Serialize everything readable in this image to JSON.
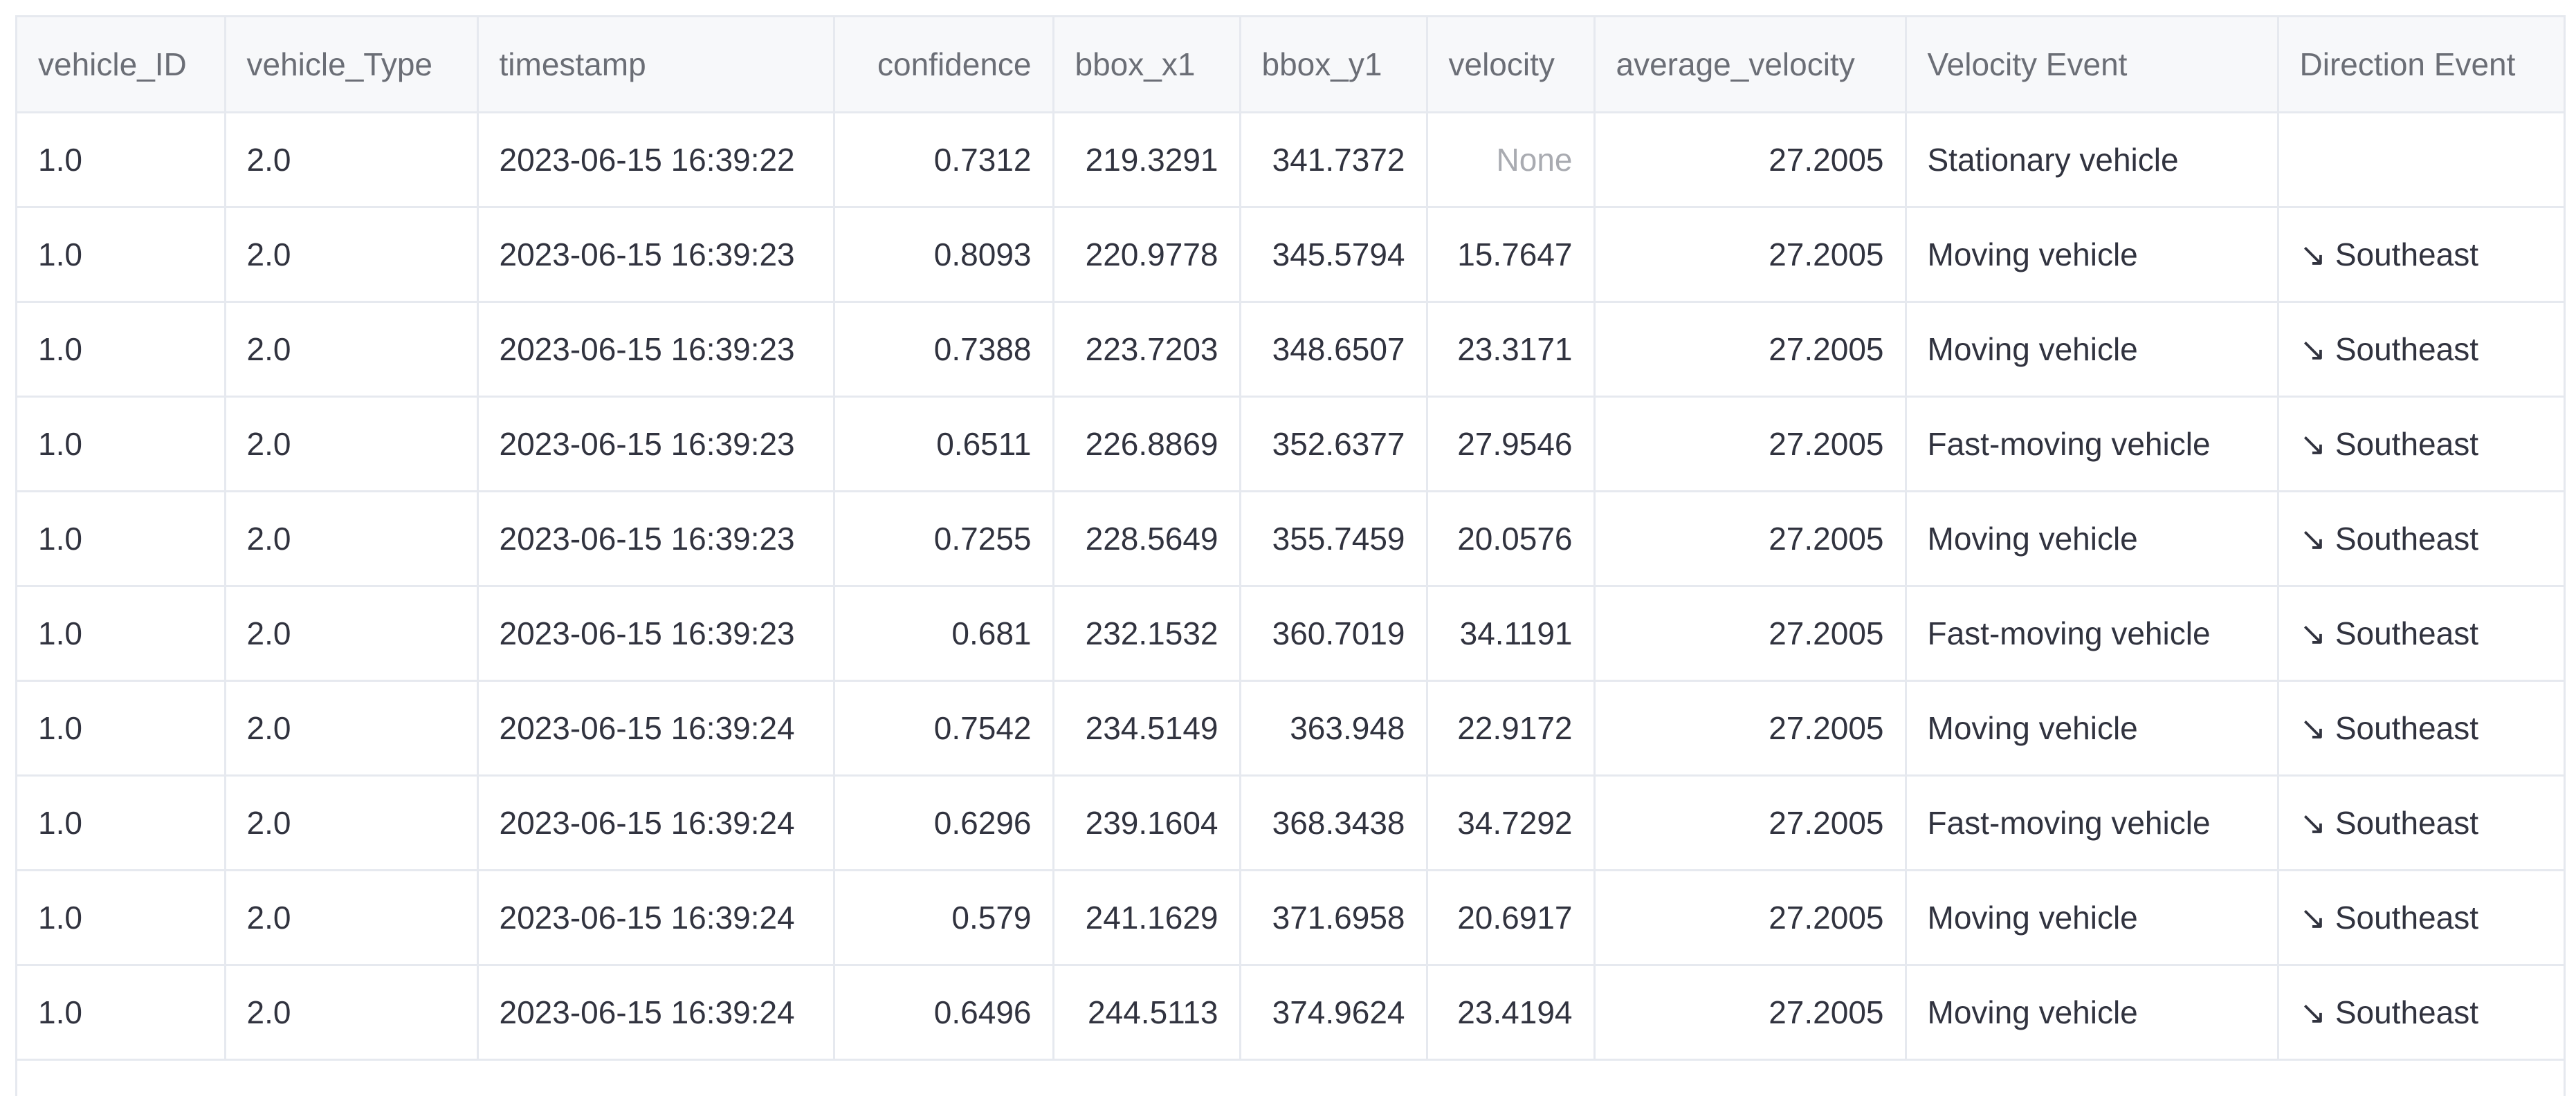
{
  "table": {
    "columns": [
      {
        "label": "vehicle_ID",
        "align": "left"
      },
      {
        "label": "vehicle_Type",
        "align": "left"
      },
      {
        "label": "timestamp",
        "align": "left"
      },
      {
        "label": "confidence",
        "align": "right"
      },
      {
        "label": "bbox_x1",
        "align": "left"
      },
      {
        "label": "bbox_y1",
        "align": "left"
      },
      {
        "label": "velocity",
        "align": "left"
      },
      {
        "label": "average_velocity",
        "align": "left"
      },
      {
        "label": "Velocity Event",
        "align": "left"
      },
      {
        "label": "Direction Event",
        "align": "left"
      }
    ],
    "rows": [
      [
        "1.0",
        "2.0",
        "2023-06-15 16:39:22",
        "0.7312",
        "219.3291",
        "341.7372",
        "None",
        "27.2005",
        "Stationary vehicle",
        ""
      ],
      [
        "1.0",
        "2.0",
        "2023-06-15 16:39:23",
        "0.8093",
        "220.9778",
        "345.5794",
        "15.7647",
        "27.2005",
        "Moving vehicle",
        "↘ Southeast"
      ],
      [
        "1.0",
        "2.0",
        "2023-06-15 16:39:23",
        "0.7388",
        "223.7203",
        "348.6507",
        "23.3171",
        "27.2005",
        "Moving vehicle",
        "↘ Southeast"
      ],
      [
        "1.0",
        "2.0",
        "2023-06-15 16:39:23",
        "0.6511",
        "226.8869",
        "352.6377",
        "27.9546",
        "27.2005",
        "Fast-moving vehicle",
        "↘ Southeast"
      ],
      [
        "1.0",
        "2.0",
        "2023-06-15 16:39:23",
        "0.7255",
        "228.5649",
        "355.7459",
        "20.0576",
        "27.2005",
        "Moving vehicle",
        "↘ Southeast"
      ],
      [
        "1.0",
        "2.0",
        "2023-06-15 16:39:23",
        "0.681",
        "232.1532",
        "360.7019",
        "34.1191",
        "27.2005",
        "Fast-moving vehicle",
        "↘ Southeast"
      ],
      [
        "1.0",
        "2.0",
        "2023-06-15 16:39:24",
        "0.7542",
        "234.5149",
        "363.948",
        "22.9172",
        "27.2005",
        "Moving vehicle",
        "↘ Southeast"
      ],
      [
        "1.0",
        "2.0",
        "2023-06-15 16:39:24",
        "0.6296",
        "239.1604",
        "368.3438",
        "34.7292",
        "27.2005",
        "Fast-moving vehicle",
        "↘ Southeast"
      ],
      [
        "1.0",
        "2.0",
        "2023-06-15 16:39:24",
        "0.579",
        "241.1629",
        "371.6958",
        "20.6917",
        "27.2005",
        "Moving vehicle",
        "↘ Southeast"
      ],
      [
        "1.0",
        "2.0",
        "2023-06-15 16:39:24",
        "0.6496",
        "244.5113",
        "374.9624",
        "23.4194",
        "27.2005",
        "Moving vehicle",
        "↘ Southeast"
      ]
    ]
  }
}
